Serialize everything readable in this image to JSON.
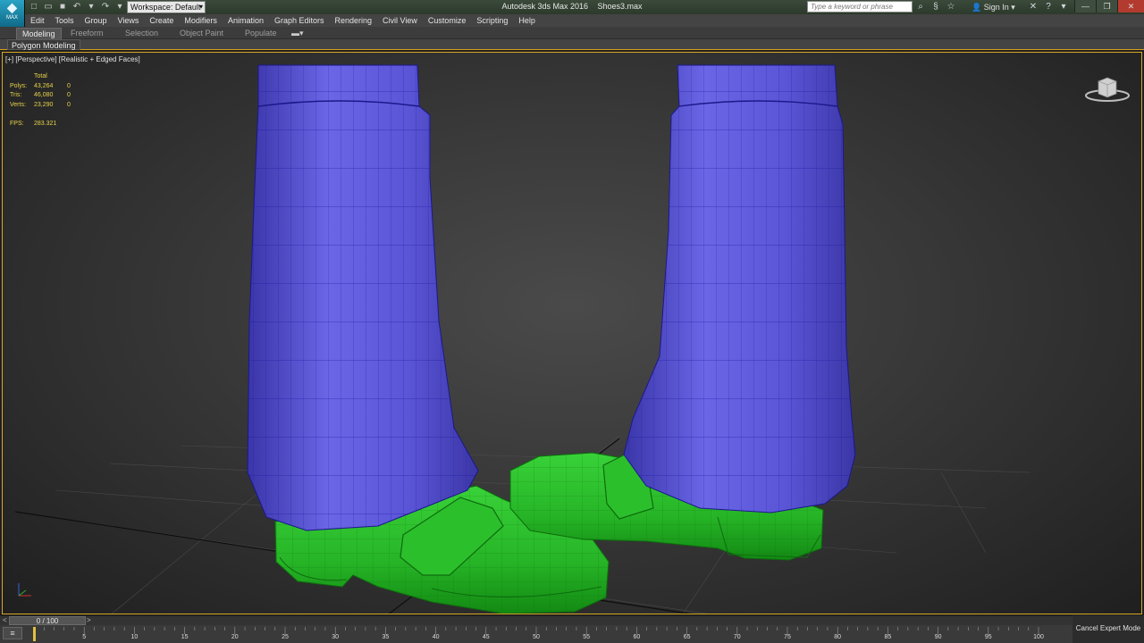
{
  "titlebar": {
    "logo_text": "MAX",
    "workspace_label": "Workspace: Default",
    "app_name": "Autodesk 3ds Max 2016",
    "file_name": "Shoes3.max",
    "search_placeholder": "Type a keyword or phrase",
    "sign_in": "Sign In"
  },
  "menu": [
    "Edit",
    "Tools",
    "Group",
    "Views",
    "Create",
    "Modifiers",
    "Animation",
    "Graph Editors",
    "Rendering",
    "Civil View",
    "Customize",
    "Scripting",
    "Help"
  ],
  "ribbon": {
    "tabs": [
      "Modeling",
      "Freeform",
      "Selection",
      "Object Paint",
      "Populate"
    ],
    "active_tab": "Modeling",
    "panel_label": "Polygon Modeling"
  },
  "viewport": {
    "label": "[+] [Perspective] [Realistic + Edged Faces]",
    "stats": {
      "header": "Total",
      "rows": [
        {
          "key": "Polys:",
          "total": "43,264",
          "sel": "0"
        },
        {
          "key": "Tris:",
          "total": "46,080",
          "sel": "0"
        },
        {
          "key": "Verts:",
          "total": "23,290",
          "sel": "0"
        }
      ],
      "fps_key": "FPS:",
      "fps_value": "283.321"
    }
  },
  "timeline": {
    "slider_text": "0 / 100",
    "left_arrow": "<",
    "right_arrow": ">",
    "ticks": [
      "5",
      "10",
      "15",
      "20",
      "25",
      "30",
      "35",
      "40",
      "45",
      "50",
      "55",
      "60",
      "65",
      "70",
      "75",
      "80",
      "85",
      "90",
      "95",
      "100"
    ],
    "current_frame": 0,
    "total_frames": 100
  },
  "status": {
    "cancel_expert": "Cancel Expert Mode"
  },
  "colors": {
    "sock": "#5a55d6",
    "shoe": "#27b827",
    "viewport_border": "#d8a825",
    "stats_text": "#e7d24a"
  }
}
